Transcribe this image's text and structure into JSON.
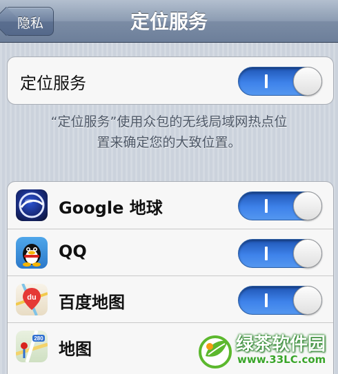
{
  "nav": {
    "title": "定位服务",
    "back_label": "隐私"
  },
  "master_toggle": {
    "label": "定位服务",
    "on": true
  },
  "footer": {
    "line1": "“定位服务”使用众包的无线局域网热点位",
    "line2": "置来确定您的大致位置。"
  },
  "apps": [
    {
      "label": "Google 地球",
      "icon": "google-earth-icon",
      "on": true
    },
    {
      "label": "QQ",
      "icon": "qq-penguin-icon",
      "on": true
    },
    {
      "label": "百度地图",
      "icon": "baidu-map-icon",
      "on": true
    },
    {
      "label": "地图",
      "icon": "maps-icon",
      "on": true
    }
  ],
  "map_icon_text": {
    "badge": "du",
    "road_number": "280"
  },
  "watermark": {
    "title": "绿茶软件园",
    "url": "www.33LC.com"
  },
  "colors": {
    "toggle_on": "#3e82ea",
    "nav_bar": "#7b8ca5",
    "background": "#cbd2dc"
  }
}
